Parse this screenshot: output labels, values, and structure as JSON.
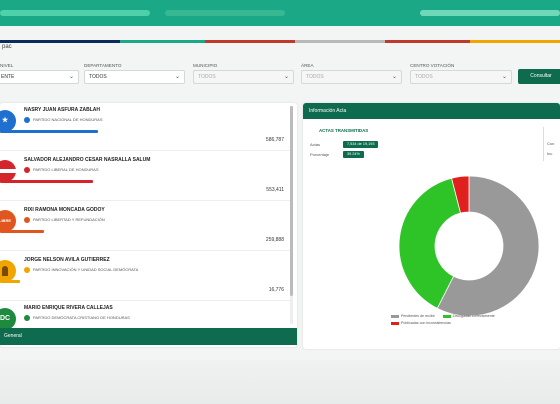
{
  "header": {
    "breadcrumb": "pac",
    "stripe_colors": [
      "#0c2b5a",
      "#1aa886",
      "#c0392b",
      "#b8b8b8",
      "#c0392b",
      "#f0a500"
    ]
  },
  "filters": [
    {
      "label": "NIVEL",
      "value": "ENTE",
      "disabled": false
    },
    {
      "label": "DEPARTAMENTO",
      "value": "TODOS",
      "disabled": false
    },
    {
      "label": "MUNICIPIO",
      "value": "TODOS",
      "disabled": true
    },
    {
      "label": "ÁREA",
      "value": "TODOS",
      "disabled": true
    },
    {
      "label": "CENTRO VOTACIÓN",
      "value": "TODOS",
      "disabled": true
    }
  ],
  "consult_button": "Consultar",
  "candidates": [
    {
      "name": "NASRY JUAN ASFURA ZABLAH",
      "party": "PARTIDO NACIONAL DE HONDURAS",
      "votes": "586,787",
      "share": 0.339,
      "color": "#1f6fd1",
      "avatar_icon": "star-icon",
      "avatar_text": "★"
    },
    {
      "name": "SALVADOR ALEJANDRO CESAR NASRALLA SALUM",
      "party": "PARTIDO LIBERAL DE HONDURAS",
      "votes": "553,411",
      "share": 0.32,
      "color": "#d4252c",
      "avatar_icon": "liberal-flag-icon",
      "avatar_text": ""
    },
    {
      "name": "RIXI RAMONA MONCADA GODOY",
      "party": "PARTIDO LIBERTAD Y REFUNDACIÓN",
      "votes": "259,888",
      "share": 0.15,
      "color": "#e0561e",
      "avatar_icon": "libre-icon",
      "avatar_text": "LIBRE"
    },
    {
      "name": "JORGE NELSON AVILA GUTIERREZ",
      "party": "PARTIDO INNOVACIÓN Y UNIDAD SOCIAL DEMÓCRATA",
      "votes": "16,776",
      "share": 0.01,
      "color": "#f0a500",
      "avatar_icon": "pinu-icon",
      "avatar_text": ""
    },
    {
      "name": "MARIO ENRIQUE RIVERA CALLEJAS",
      "party": "PARTIDO DEMÓCRATA CRISTIANO DE HONDURAS",
      "votes": "",
      "share": 0.0,
      "color": "#1e8a3e",
      "avatar_icon": "dc-icon",
      "avatar_text": "DC"
    }
  ],
  "general_label": "General",
  "info_panel": {
    "title": "Información Acta",
    "actas_title": "ACTAS TRANSMITIDAS",
    "rows": [
      {
        "label": "Actas",
        "value": "7,534 de 19,193"
      },
      {
        "label": "Porcentaje",
        "value": "39.24%"
      }
    ],
    "right_labels": [
      "Con",
      "Inc"
    ]
  },
  "chart_data": {
    "type": "pie",
    "categories": [
      "Pendientes de recibir",
      "Divulgadas correctamente",
      "Publicadas con inconsistencias"
    ],
    "values": [
      57.5,
      38.5,
      4.0
    ],
    "colors": [
      "#999999",
      "#2ec427",
      "#e0201e"
    ]
  }
}
